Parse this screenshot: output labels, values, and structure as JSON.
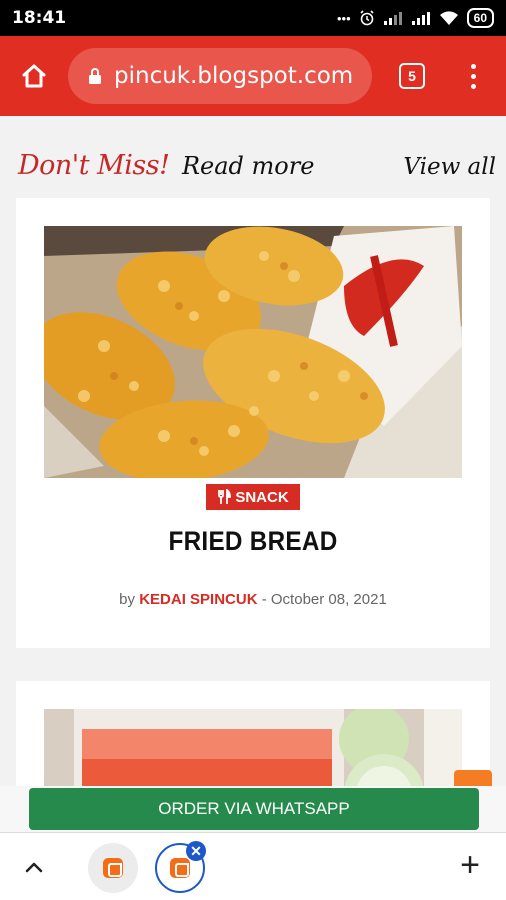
{
  "status_bar": {
    "time": "18:41",
    "dots": "•••",
    "battery": "60"
  },
  "browser": {
    "url": "pincuk.blogspot.com",
    "tab_count": "5"
  },
  "section": {
    "heading_red": "Don't Miss!",
    "heading_black": "Read more",
    "view_all": "View all"
  },
  "post": {
    "category": "SNACK",
    "title": "FRIED BREAD",
    "by": "by",
    "author": "KEDAI SPINCUK",
    "date_sep": " - ",
    "date": "October 08, 2021"
  },
  "cta": {
    "label": "ORDER VIA WHATSAPP"
  },
  "icons": [
    "home-icon",
    "lock-icon",
    "tabs-icon",
    "more-vert-icon",
    "fork-knife-icon",
    "chevron-up-icon",
    "blogger-icon",
    "close-icon",
    "plus-icon",
    "alarm-icon",
    "signal-icon",
    "wifi-icon",
    "battery-icon"
  ],
  "colors": {
    "toolbar": "#e02e22",
    "accent_red": "#d72c23",
    "whatsapp_green": "#258a4c",
    "tab_blue": "#1e58c8"
  }
}
